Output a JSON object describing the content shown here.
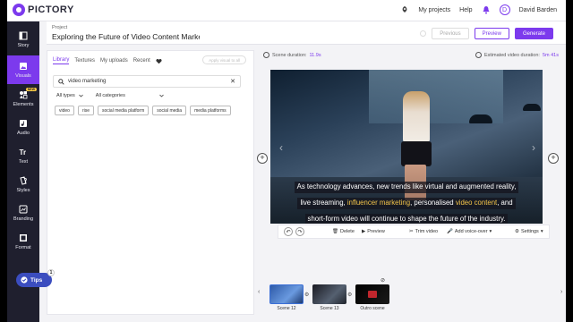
{
  "app": {
    "logo_text": "PICTORY",
    "brand_color": "#7c3aed"
  },
  "topbar": {
    "rocket_icon": "rocket-icon",
    "my_projects": "My projects",
    "help": "Help",
    "bell_icon": "bell-icon",
    "avatar_initial": "D",
    "user_name": "David Barden"
  },
  "project": {
    "label": "Project",
    "title": "Exploring the Future of Video Content Market",
    "buttons": {
      "previous": "Previous",
      "preview": "Preview",
      "generate": "Generate"
    }
  },
  "sidebar": {
    "items": [
      {
        "label": "Story",
        "icon": "story-icon"
      },
      {
        "label": "Visuals",
        "icon": "visuals-icon",
        "active": true
      },
      {
        "label": "Elements",
        "icon": "elements-icon",
        "badge": "NEW"
      },
      {
        "label": "Audio",
        "icon": "audio-icon"
      },
      {
        "label": "Text",
        "icon": "text-icon"
      },
      {
        "label": "Styles",
        "icon": "styles-icon"
      },
      {
        "label": "Branding",
        "icon": "branding-icon"
      },
      {
        "label": "Format",
        "icon": "format-icon"
      }
    ],
    "tips": {
      "label": "Tips",
      "count": "1"
    }
  },
  "library": {
    "tabs": [
      "Library",
      "Textures",
      "My uploads",
      "Recent"
    ],
    "apply_all": "Apply visual to all",
    "search_value": "video marketing",
    "filters": {
      "type": "All types",
      "category": "All categories"
    },
    "chips": [
      "video",
      "rise",
      "social media platform",
      "social media",
      "media platforms"
    ]
  },
  "editor": {
    "scene_duration_label": "Scene duration:",
    "scene_duration_value": "11.9s",
    "estimated_label": "Estimated video duration:",
    "estimated_value": "5m 41s",
    "caption": {
      "line1": "As technology advances, new trends like virtual and augmented reality,",
      "line2_a": "live streaming, ",
      "line2_hl1": "influencer marketing",
      "line2_b": ", personalised ",
      "line2_hl2": "video content",
      "line2_c": ", and",
      "line3": "short-form video will continue to shape the future of the industry."
    },
    "toolbar": {
      "delete": "Delete",
      "preview": "Preview",
      "trim": "Trim video",
      "voiceover": "Add voice-over",
      "settings": "Settings"
    }
  },
  "timeline": {
    "scenes": [
      {
        "label": "Scene 12",
        "active": true
      },
      {
        "label": "Scene 13"
      },
      {
        "label": "Outro scene"
      }
    ]
  }
}
